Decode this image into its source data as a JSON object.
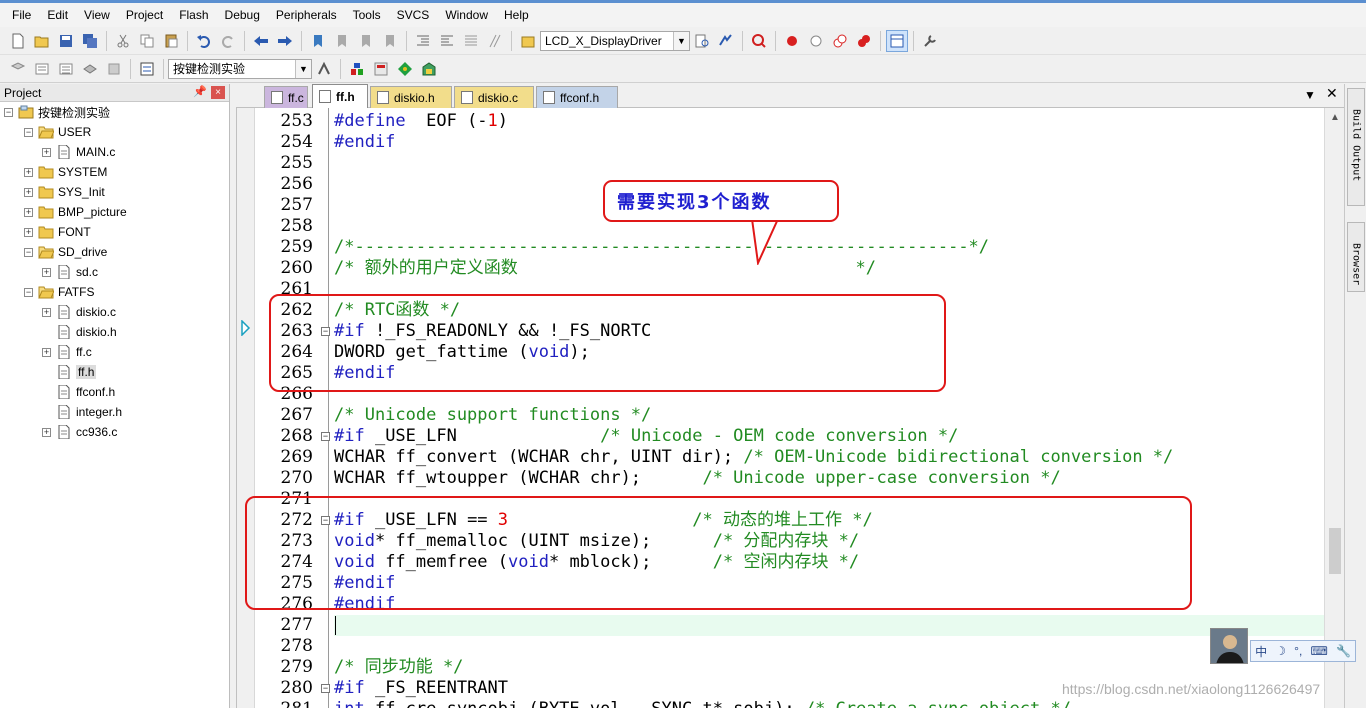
{
  "menubar": {
    "items": [
      "File",
      "Edit",
      "View",
      "Project",
      "Flash",
      "Debug",
      "Peripherals",
      "Tools",
      "SVCS",
      "Window",
      "Help"
    ]
  },
  "toolbar": {
    "target_combo": "LCD_X_DisplayDriver",
    "project_combo": "按键检测实验"
  },
  "project_panel": {
    "title": "Project",
    "pin_icon": "pin-icon",
    "tree": [
      {
        "label": "按键检测实验",
        "kind": "root"
      },
      {
        "label": "USER",
        "kind": "folder"
      },
      {
        "label": "MAIN.c",
        "kind": "file"
      },
      {
        "label": "SYSTEM",
        "kind": "folder"
      },
      {
        "label": "SYS_Init",
        "kind": "folder"
      },
      {
        "label": "BMP_picture",
        "kind": "folder"
      },
      {
        "label": "FONT",
        "kind": "folder"
      },
      {
        "label": "SD_drive",
        "kind": "folder"
      },
      {
        "label": "sd.c",
        "kind": "file"
      },
      {
        "label": "FATFS",
        "kind": "folder"
      },
      {
        "label": "diskio.c",
        "kind": "file"
      },
      {
        "label": "diskio.h",
        "kind": "file"
      },
      {
        "label": "ff.c",
        "kind": "file"
      },
      {
        "label": "ff.h",
        "kind": "file",
        "selected": true
      },
      {
        "label": "ffconf.h",
        "kind": "file"
      },
      {
        "label": "integer.h",
        "kind": "file"
      },
      {
        "label": "cc936.c",
        "kind": "file"
      }
    ]
  },
  "tabs": [
    {
      "label": "ff.c"
    },
    {
      "label": "ff.h",
      "active": true
    },
    {
      "label": "diskio.h"
    },
    {
      "label": "diskio.c"
    },
    {
      "label": "ffconf.h"
    }
  ],
  "editor": {
    "line_numbers": [
      "253",
      "254",
      "255",
      "256",
      "257",
      "258",
      "259",
      "260",
      "261",
      "262",
      "263",
      "264",
      "265",
      "266",
      "267",
      "268",
      "269",
      "270",
      "271",
      "272",
      "273",
      "274",
      "275",
      "276",
      "277",
      "278",
      "279",
      "280",
      "281"
    ],
    "lines": [
      [
        [
          "kw",
          "#define"
        ],
        [
          "",
          "  EOF (-"
        ],
        [
          "nm",
          "1"
        ],
        [
          "",
          ")"
        ]
      ],
      [
        [
          "kw",
          "#endif"
        ]
      ],
      [],
      [],
      [],
      [],
      [
        [
          "cm",
          "/*------------------------------------------------------------*/"
        ]
      ],
      [
        [
          "cm",
          "/* 额外的用户定义函数                                 */"
        ]
      ],
      [],
      [
        [
          "cm",
          "/* RTC函数 */"
        ]
      ],
      [
        [
          "kw",
          "#if"
        ],
        [
          "",
          " !_FS_READONLY && !_FS_NORTC"
        ]
      ],
      [
        [
          "",
          "DWORD get_fattime ("
        ],
        [
          "kw",
          "void"
        ],
        [
          "",
          ");"
        ]
      ],
      [
        [
          "kw",
          "#endif"
        ]
      ],
      [],
      [
        [
          "cm",
          "/* Unicode support functions */"
        ]
      ],
      [
        [
          "kw",
          "#if"
        ],
        [
          "",
          " _USE_LFN              "
        ],
        [
          "cm",
          "/* Unicode - OEM code conversion */"
        ]
      ],
      [
        [
          "",
          "WCHAR ff_convert (WCHAR chr, UINT dir); "
        ],
        [
          "cm",
          "/* OEM-Unicode bidirectional conversion */"
        ]
      ],
      [
        [
          "",
          "WCHAR ff_wtoupper (WCHAR chr);      "
        ],
        [
          "cm",
          "/* Unicode upper-case conversion */"
        ]
      ],
      [],
      [
        [
          "kw",
          "#if"
        ],
        [
          "",
          " _USE_LFN == "
        ],
        [
          "nm",
          "3"
        ],
        [
          "",
          "                  "
        ],
        [
          "cm",
          "/* 动态的堆上工作 */"
        ]
      ],
      [
        [
          "kw",
          "void"
        ],
        [
          "",
          "* ff_memalloc (UINT msize);      "
        ],
        [
          "cm",
          "/* 分配内存块 */"
        ]
      ],
      [
        [
          "kw",
          "void"
        ],
        [
          "",
          " ff_memfree ("
        ],
        [
          "kw",
          "void"
        ],
        [
          "",
          "* mblock);      "
        ],
        [
          "cm",
          "/* 空闲内存块 */"
        ]
      ],
      [
        [
          "kw",
          "#endif"
        ]
      ],
      [
        [
          "kw",
          "#endif"
        ]
      ],
      [],
      [],
      [
        [
          "cm",
          "/* 同步功能 */"
        ]
      ],
      [
        [
          "kw",
          "#if"
        ],
        [
          "",
          " _FS_REENTRANT"
        ]
      ],
      [
        [
          "kw",
          "int"
        ],
        [
          "",
          " ff_cre_syncobj (BYTE vol, _SYNC_t* sobj); "
        ],
        [
          "cm",
          "/* Create a sync object */"
        ]
      ]
    ]
  },
  "annotation": {
    "callout_text": "需要实现3个函数"
  },
  "right_dock": {
    "build_output": "Build Output",
    "browser": "Browser"
  },
  "ime": {
    "label": "中"
  },
  "watermark": "https://blog.csdn.net/xiaolong1126626497"
}
